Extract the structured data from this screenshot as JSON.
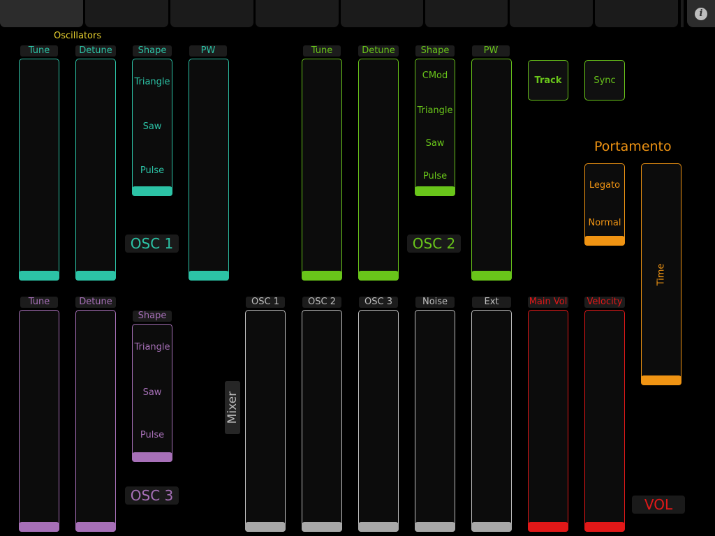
{
  "colors": {
    "osc1": "#2cc3a6",
    "osc2": "#69c51a",
    "osc3": "#a770b8",
    "mixer": "#bfbfbf",
    "mixer_handle": "#a8a8a8",
    "vol": "#e11818",
    "portamento": "#f09413",
    "section_title": "#e6cf2e"
  },
  "header": {
    "tabs": [
      "",
      "",
      "",
      "",
      "",
      "",
      "",
      ""
    ],
    "info_icon_glyph": "i"
  },
  "oscillators": {
    "title": "Oscillators",
    "osc1": {
      "name": "OSC 1",
      "tune": {
        "label": "Tune",
        "value": 0
      },
      "detune": {
        "label": "Detune",
        "value": 0
      },
      "shape": {
        "label": "Shape",
        "options": [
          "Triangle",
          "Saw",
          "Pulse"
        ]
      },
      "pw": {
        "label": "PW",
        "value": 0
      }
    },
    "osc2": {
      "name": "OSC 2",
      "tune": {
        "label": "Tune",
        "value": 0
      },
      "detune": {
        "label": "Detune",
        "value": 0
      },
      "shape": {
        "label": "Shape",
        "options": [
          "CMod",
          "Triangle",
          "Saw",
          "Pulse"
        ]
      },
      "pw": {
        "label": "PW",
        "value": 0
      },
      "track_label": "Track",
      "sync_label": "Sync"
    },
    "osc3": {
      "name": "OSC 3",
      "tune": {
        "label": "Tune",
        "value": 0
      },
      "detune": {
        "label": "Detune",
        "value": 0
      },
      "shape": {
        "label": "Shape",
        "options": [
          "Triangle",
          "Saw",
          "Pulse"
        ]
      }
    }
  },
  "portamento": {
    "title": "Portamento",
    "mode_options": [
      "Legato",
      "Normal"
    ],
    "time_label": "Time",
    "time_value": 0
  },
  "mixer": {
    "title": "Mixer",
    "channels": [
      {
        "label": "OSC 1",
        "value": 0
      },
      {
        "label": "OSC 2",
        "value": 0
      },
      {
        "label": "OSC 3",
        "value": 0
      },
      {
        "label": "Noise",
        "value": 0
      },
      {
        "label": "Ext",
        "value": 0
      }
    ]
  },
  "volume": {
    "title": "VOL",
    "main_vol": {
      "label": "Main Vol",
      "value": 0
    },
    "velocity": {
      "label": "Velocity",
      "value": 0
    }
  }
}
